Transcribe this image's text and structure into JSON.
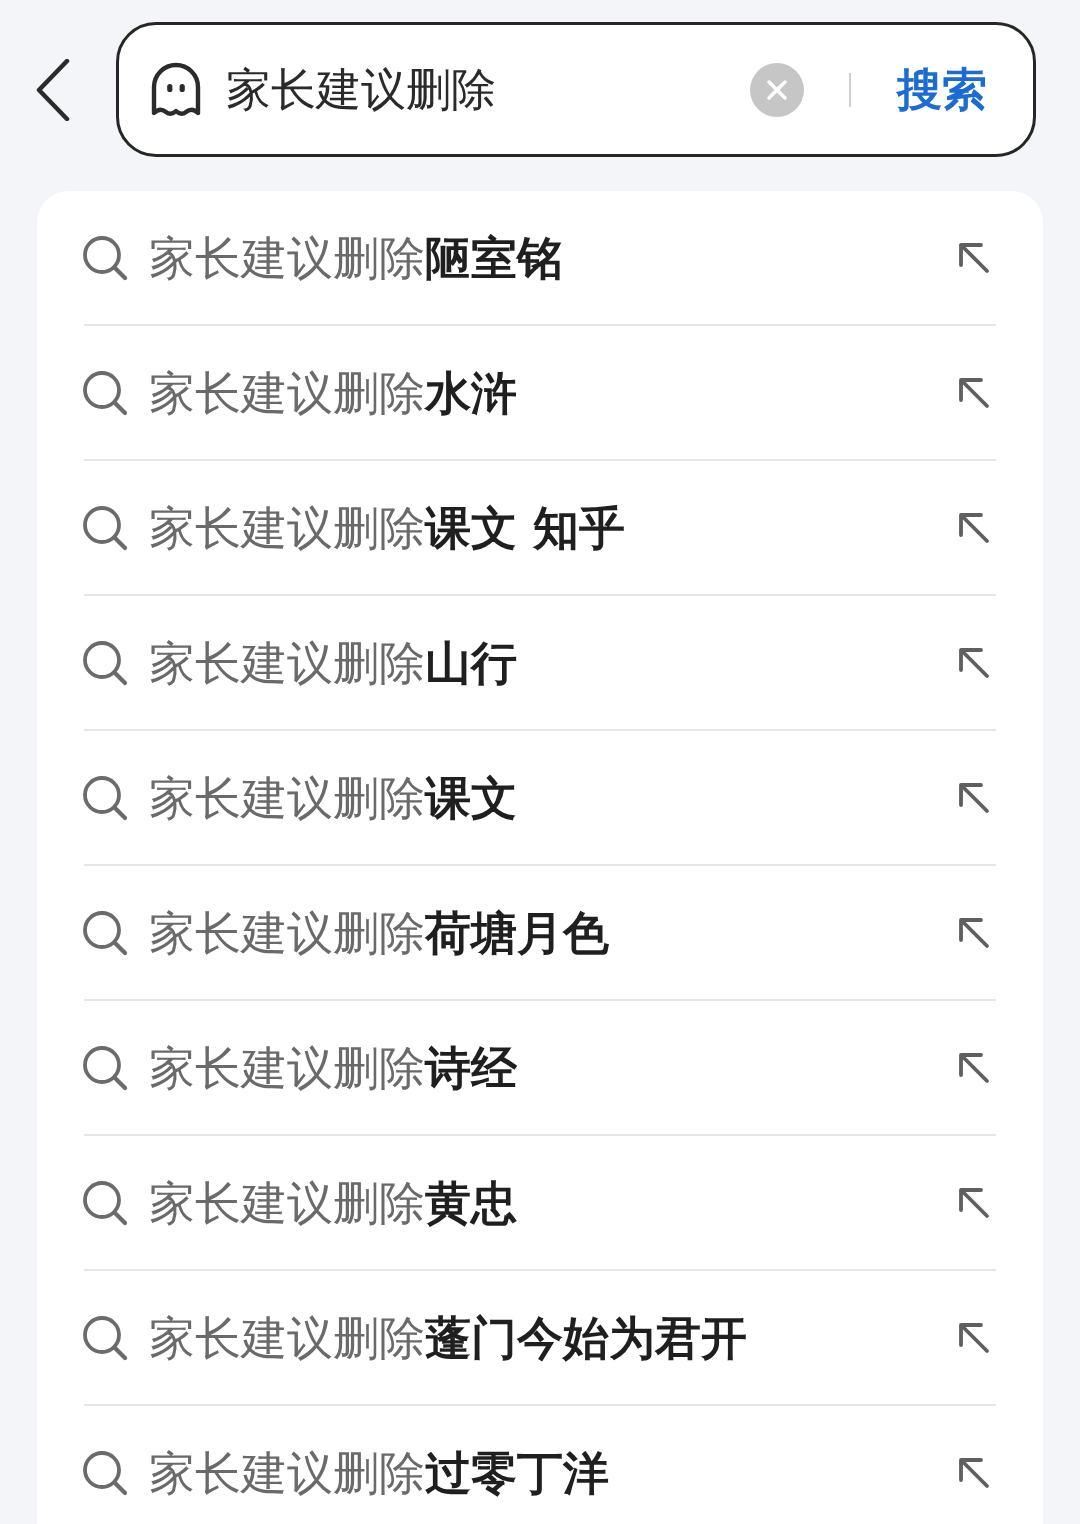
{
  "search": {
    "value": "家长建议删除",
    "button": "搜索"
  },
  "suggestions": [
    {
      "text": "家长建议删除**陋室铭**"
    },
    {
      "text": "家长建议删除**水浒**"
    },
    {
      "text": "家长建议删除**课文 知乎**"
    },
    {
      "text": "家长建议删除**山行**"
    },
    {
      "text": "家长建议删除**课文**"
    },
    {
      "text": "家长建议删除**荷塘月色**"
    },
    {
      "text": "家长建议删除**诗经**"
    },
    {
      "text": "家长建议删除**黄忠**"
    },
    {
      "text": "家长建议删除**蓬门今始为君开**"
    },
    {
      "text": "家长建议删除**过零丁洋**"
    }
  ]
}
